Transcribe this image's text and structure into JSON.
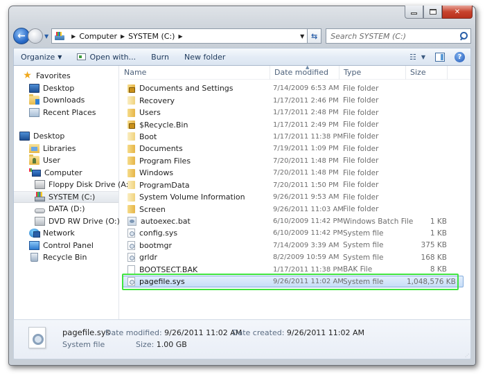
{
  "window": {
    "caption_buttons": {
      "minimize": "minimize",
      "maximize": "maximize",
      "close": "x"
    }
  },
  "address": {
    "crumbs": [
      "Computer",
      "SYSTEM (C:)"
    ],
    "search_placeholder": "Search SYSTEM (C:)"
  },
  "toolbar": {
    "organize": "Organize",
    "open_with": "Open with...",
    "burn": "Burn",
    "new_folder": "New folder"
  },
  "nav": {
    "favorites": {
      "label": "Favorites",
      "items": [
        "Desktop",
        "Downloads",
        "Recent Places"
      ]
    },
    "desktop": "Desktop",
    "libraries": "Libraries",
    "user": "User",
    "computer": "Computer",
    "drives": [
      "Floppy Disk Drive (A:)",
      "SYSTEM (C:)",
      "DATA (D:)",
      "DVD RW Drive (O:)"
    ],
    "network": "Network",
    "control_panel": "Control Panel",
    "recycle_bin": "Recycle Bin",
    "selected": "SYSTEM (C:)"
  },
  "columns": [
    "Name",
    "Date modified",
    "Type",
    "Size"
  ],
  "files": [
    {
      "name": "Documents and Settings",
      "date": "7/14/2009 6:53 AM",
      "type": "File folder",
      "size": "",
      "icon": "folder-lock-icon"
    },
    {
      "name": "Recovery",
      "date": "1/17/2011 2:46 PM",
      "type": "File folder",
      "size": "",
      "icon": "folder-icon"
    },
    {
      "name": "Users",
      "date": "1/17/2011 2:48 PM",
      "type": "File folder",
      "size": "",
      "icon": "folder-icon"
    },
    {
      "name": "$Recycle.Bin",
      "date": "1/17/2011 2:49 PM",
      "type": "File folder",
      "size": "",
      "icon": "folder-lock-icon"
    },
    {
      "name": "Boot",
      "date": "1/17/2011 11:38 PM",
      "type": "File folder",
      "size": "",
      "icon": "folder-icon"
    },
    {
      "name": "Documents",
      "date": "7/19/2011 1:09 PM",
      "type": "File folder",
      "size": "",
      "icon": "folder-icon"
    },
    {
      "name": "Program Files",
      "date": "7/20/2011 1:48 PM",
      "type": "File folder",
      "size": "",
      "icon": "folder-icon"
    },
    {
      "name": "Windows",
      "date": "7/20/2011 1:48 PM",
      "type": "File folder",
      "size": "",
      "icon": "folder-icon"
    },
    {
      "name": "ProgramData",
      "date": "7/20/2011 1:50 PM",
      "type": "File folder",
      "size": "",
      "icon": "folder-icon"
    },
    {
      "name": "System Volume Information",
      "date": "9/26/2011 9:53 AM",
      "type": "File folder",
      "size": "",
      "icon": "folder-icon"
    },
    {
      "name": "Screen",
      "date": "9/26/2011 11:03 AM",
      "type": "File folder",
      "size": "",
      "icon": "folder-icon"
    },
    {
      "name": "autoexec.bat",
      "date": "6/10/2009 11:42 PM",
      "type": "Windows Batch File",
      "size": "1 KB",
      "icon": "batch-file-icon"
    },
    {
      "name": "config.sys",
      "date": "6/10/2009 11:42 PM",
      "type": "System file",
      "size": "1 KB",
      "icon": "system-file-icon"
    },
    {
      "name": "bootmgr",
      "date": "7/14/2009 3:39 AM",
      "type": "System file",
      "size": "375 KB",
      "icon": "system-file-icon"
    },
    {
      "name": "grldr",
      "date": "8/2/2009 10:59 AM",
      "type": "System file",
      "size": "168 KB",
      "icon": "system-file-icon"
    },
    {
      "name": "BOOTSECT.BAK",
      "date": "1/17/2011 11:38 PM",
      "type": "BAK File",
      "size": "8 KB",
      "icon": "blank-file-icon"
    },
    {
      "name": "pagefile.sys",
      "date": "9/26/2011 11:02 AM",
      "type": "System file",
      "size": "1,048,576 KB",
      "icon": "system-file-icon",
      "selected": true
    }
  ],
  "details": {
    "name": "pagefile.sys",
    "type": "System file",
    "date_modified_label": "Date modified:",
    "date_modified": "9/26/2011 11:02 AM",
    "size_label": "Size:",
    "size": "1.00 GB",
    "date_created_label": "Date created:",
    "date_created": "9/26/2011 11:02 AM"
  },
  "colors": {
    "highlight_outline": "#3fe33f",
    "selection": "#c7ddf7"
  }
}
